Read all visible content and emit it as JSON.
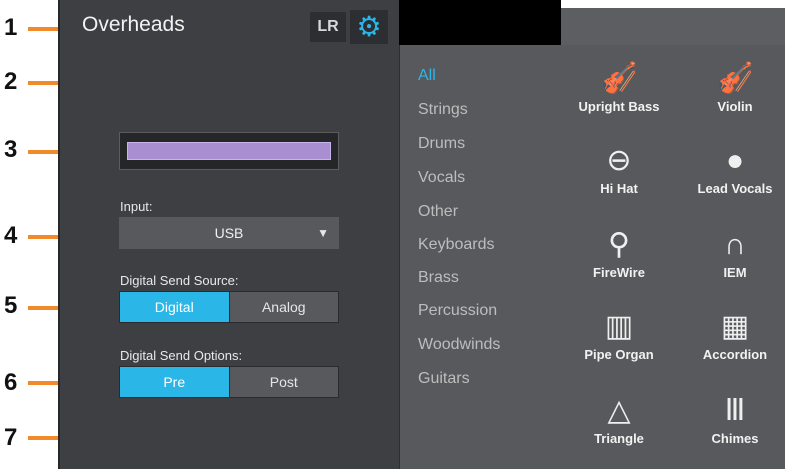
{
  "callouts": [
    "1",
    "2",
    "3",
    "4",
    "5",
    "6",
    "7"
  ],
  "header": {
    "title": "Overheads",
    "lr_label": "LR",
    "gear_icon": "gear-icon"
  },
  "input": {
    "label": "Input:",
    "value": "USB"
  },
  "send_source": {
    "label": "Digital Send Source:",
    "options": [
      "Digital",
      "Analog"
    ],
    "selected": "Digital"
  },
  "send_options": {
    "label": "Digital Send Options:",
    "options": [
      "Pre",
      "Post"
    ],
    "selected": "Pre"
  },
  "categories": [
    "All",
    "Strings",
    "Drums",
    "Vocals",
    "Other",
    "Keyboards",
    "Brass",
    "Percussion",
    "Woodwinds",
    "Guitars"
  ],
  "selected_category": "All",
  "instruments": [
    {
      "name": "Upright Bass",
      "icon": "upright-bass-icon"
    },
    {
      "name": "Violin",
      "icon": "violin-icon"
    },
    {
      "name": "Hi Hat",
      "icon": "hi-hat-icon"
    },
    {
      "name": "Lead Vocals",
      "icon": "lead-vocals-icon"
    },
    {
      "name": "FireWire",
      "icon": "firewire-icon"
    },
    {
      "name": "IEM",
      "icon": "headphones-icon"
    },
    {
      "name": "Pipe Organ",
      "icon": "pipe-organ-icon"
    },
    {
      "name": "Accordion",
      "icon": "accordion-icon"
    },
    {
      "name": "Triangle",
      "icon": "triangle-icon"
    },
    {
      "name": "Chimes",
      "icon": "chimes-icon"
    }
  ],
  "colors": {
    "accent": "#2bb6e8",
    "callout": "#f08a2a",
    "swatch": "#a98fd2"
  }
}
